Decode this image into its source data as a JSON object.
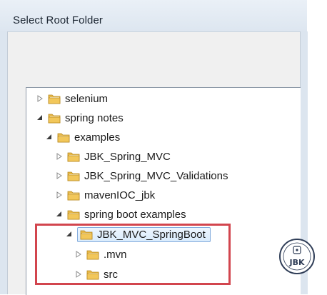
{
  "dialog": {
    "title": "Select Root Folder"
  },
  "tree": {
    "items": [
      {
        "label": "selenium",
        "expander": "collapsed"
      },
      {
        "label": "spring notes",
        "expander": "expanded"
      },
      {
        "label": "examples",
        "expander": "expanded"
      },
      {
        "label": "JBK_Spring_MVC",
        "expander": "collapsed"
      },
      {
        "label": "JBK_Spring_MVC_Validations",
        "expander": "collapsed"
      },
      {
        "label": "mavenIOC_jbk",
        "expander": "collapsed"
      },
      {
        "label": "spring boot examples",
        "expander": "expanded"
      },
      {
        "label": "JBK_MVC_SpringBoot",
        "expander": "expanded",
        "selected": true
      },
      {
        "label": ".mvn",
        "expander": "collapsed"
      },
      {
        "label": "src",
        "expander": "collapsed"
      }
    ]
  },
  "watermark": {
    "label": "JBK"
  },
  "colors": {
    "highlight_box": "#d2454e",
    "selection": "#d9ebfc",
    "folder": "#e8b64a"
  },
  "icons": {
    "folder": "folder-icon",
    "collapsed": "triangle-right-icon",
    "expanded": "triangle-down-icon"
  }
}
